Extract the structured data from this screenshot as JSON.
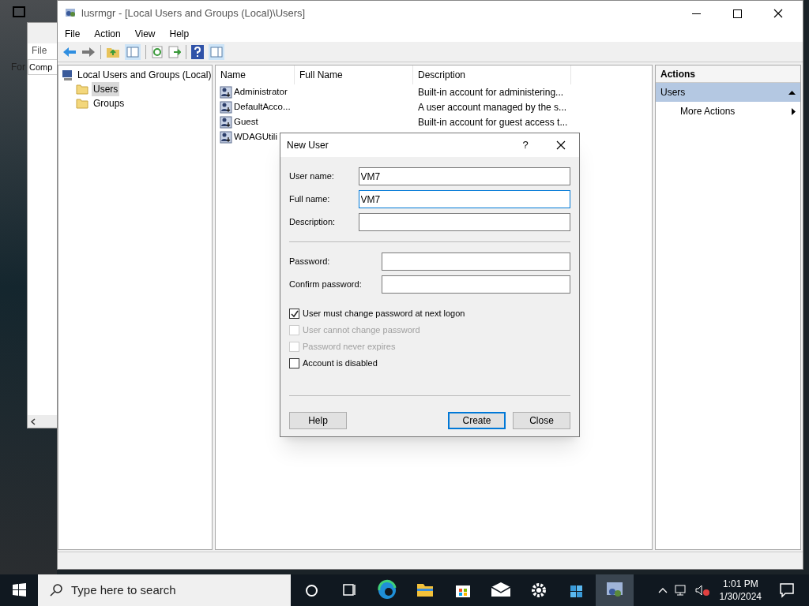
{
  "background_window": {
    "menu": "File",
    "address": "Comp",
    "side_label": "For"
  },
  "window": {
    "title": "lusrmgr - [Local Users and Groups (Local)\\Users]"
  },
  "menu": [
    "File",
    "Action",
    "View",
    "Help"
  ],
  "tree": {
    "label": "Local Users and Groups (Local)",
    "children": [
      {
        "label": "Users",
        "selected": true
      },
      {
        "label": "Groups",
        "selected": false
      }
    ]
  },
  "table": {
    "columns": [
      "Name",
      "Full Name",
      "Description"
    ],
    "rows": [
      {
        "name": "Administrator",
        "description": "Built-in account for administering..."
      },
      {
        "name": "DefaultAcco...",
        "description": "A user account managed by the s..."
      },
      {
        "name": "Guest",
        "description": "Built-in account for guest access t..."
      },
      {
        "name": "WDAGUtili"
      }
    ]
  },
  "actions": {
    "title": "Actions",
    "section": "Users",
    "items": [
      "More Actions"
    ]
  },
  "dialog": {
    "title": "New User",
    "help_glyph": "?",
    "fields": [
      {
        "label": "User name:",
        "value": "VM7",
        "focused": false
      },
      {
        "label": "Full name:",
        "value": "VM7",
        "focused": true
      },
      {
        "label": "Description:",
        "focused": false
      }
    ],
    "password_fields": [
      {
        "label": "Password:"
      },
      {
        "label": "Confirm password:"
      }
    ],
    "checkboxes": [
      {
        "label": "User must change password at next logon",
        "checked": true,
        "disabled": false
      },
      {
        "label": "User cannot change password",
        "checked": false,
        "disabled": true
      },
      {
        "label": "Password never expires",
        "checked": false,
        "disabled": true
      },
      {
        "label": "Account is disabled",
        "checked": false,
        "disabled": false
      }
    ],
    "buttons": [
      {
        "label": "Help",
        "default": false
      },
      {
        "label": "Create",
        "default": true
      },
      {
        "label": "Close",
        "default": false
      }
    ]
  },
  "taskbar": {
    "search_placeholder": "Type here to search",
    "time": "1:01 PM",
    "date": "1/30/2024"
  }
}
